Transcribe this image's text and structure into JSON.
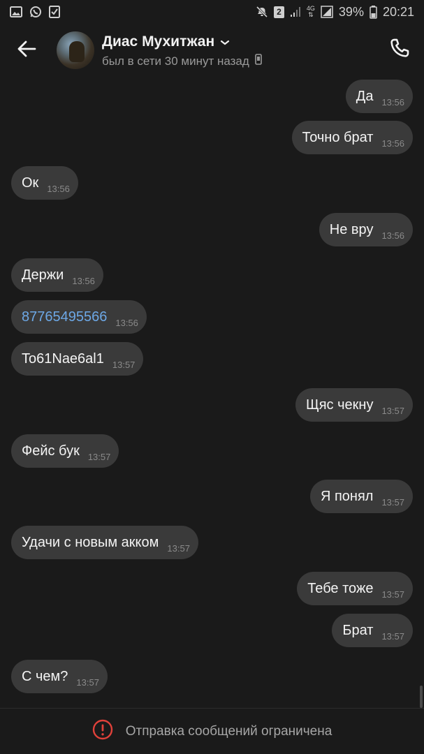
{
  "status_bar": {
    "sim": "2",
    "network": "4G",
    "battery": "39%",
    "time": "20:21",
    "icons": [
      "gallery-icon",
      "whatsapp-icon",
      "checkbox-icon",
      "mute-icon",
      "signal-icon",
      "battery-icon"
    ]
  },
  "header": {
    "name": "Диас Мухитжан",
    "status": "был в сети 30 минут назад"
  },
  "messages": [
    {
      "dir": "out",
      "text": "Да",
      "time": "13:56"
    },
    {
      "dir": "out",
      "text": "Точно брат",
      "time": "13:56"
    },
    {
      "dir": "in",
      "text": "Ок",
      "time": "13:56"
    },
    {
      "dir": "out",
      "text": "Не вру",
      "time": "13:56"
    },
    {
      "dir": "in",
      "text": "Держи",
      "time": "13:56"
    },
    {
      "dir": "in",
      "text": "87765495566",
      "time": "13:56",
      "link": true
    },
    {
      "dir": "in",
      "text": "To61Nae6al1",
      "time": "13:57"
    },
    {
      "dir": "out",
      "text": "Щяс чекну",
      "time": "13:57"
    },
    {
      "dir": "in",
      "text": "Фейс бук",
      "time": "13:57"
    },
    {
      "dir": "out",
      "text": "Я понял",
      "time": "13:57"
    },
    {
      "dir": "in",
      "text": "Удачи с новым акком",
      "time": "13:57"
    },
    {
      "dir": "out",
      "text": "Тебе тоже",
      "time": "13:57"
    },
    {
      "dir": "out",
      "text": "Брат",
      "time": "13:57"
    },
    {
      "dir": "in",
      "text": "С чем?",
      "time": "13:57"
    }
  ],
  "footer": {
    "text": "Отправка сообщений ограничена"
  },
  "colors": {
    "background": "#1a1a1a",
    "bubble": "#3a3a3a",
    "link": "#6da8e6",
    "warning": "#e0413a"
  }
}
